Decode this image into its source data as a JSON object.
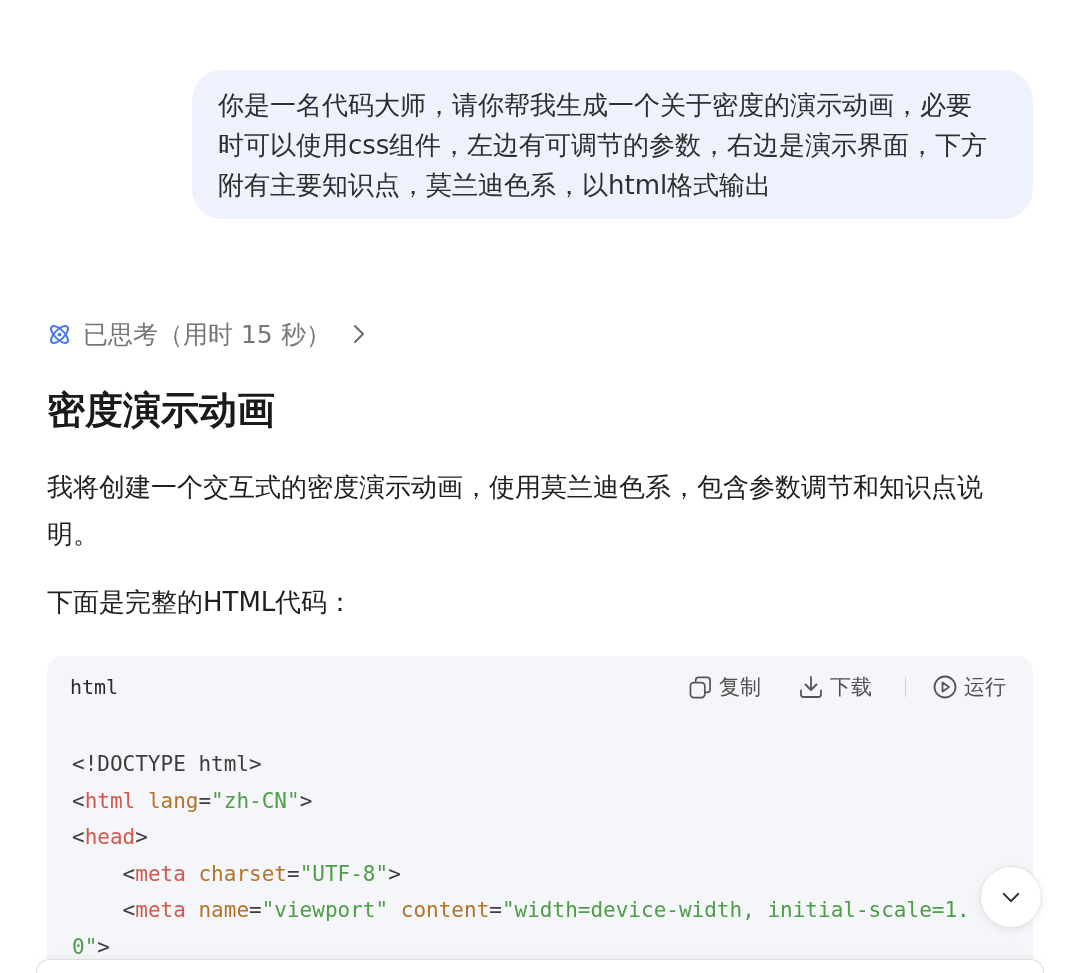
{
  "user_message": {
    "text": "你是一名代码大师，请你帮我生成一个关于密度的演示动画，必要时可以使用css组件，左边有可调节的参数，右边是演示界面，下方附有主要知识点，莫兰迪色系，以html格式输出"
  },
  "thinking": {
    "label": "已思考（用时 15 秒）",
    "expanded": false
  },
  "answer": {
    "heading": "密度演示动画",
    "paragraphs": [
      "我将创建一个交互式的密度演示动画，使用莫兰迪色系，包含参数调节和知识点说明。",
      "下面是完整的HTML代码："
    ]
  },
  "code_block": {
    "language": "html",
    "actions": [
      {
        "kind": "copy",
        "label": "复制"
      },
      {
        "kind": "download",
        "label": "下载"
      },
      {
        "kind": "separator"
      },
      {
        "kind": "run",
        "label": "运行"
      }
    ],
    "lines": [
      [
        {
          "kind": "plain",
          "text": "<!DOCTYPE html>"
        }
      ],
      [
        {
          "kind": "plain",
          "text": "<"
        },
        {
          "kind": "tag",
          "text": "html"
        },
        {
          "kind": "attr",
          "text": " lang"
        },
        {
          "kind": "plain",
          "text": "="
        },
        {
          "kind": "string",
          "text": "\"zh-CN\""
        },
        {
          "kind": "plain",
          "text": ">"
        }
      ],
      [
        {
          "kind": "plain",
          "text": "<"
        },
        {
          "kind": "tag",
          "text": "head"
        },
        {
          "kind": "plain",
          "text": ">"
        }
      ],
      [
        {
          "kind": "plain",
          "text": "    <"
        },
        {
          "kind": "tag",
          "text": "meta"
        },
        {
          "kind": "attr",
          "text": " charset"
        },
        {
          "kind": "plain",
          "text": "="
        },
        {
          "kind": "string",
          "text": "\"UTF-8\""
        },
        {
          "kind": "plain",
          "text": ">"
        }
      ],
      [
        {
          "kind": "plain",
          "text": "    <"
        },
        {
          "kind": "tag",
          "text": "meta"
        },
        {
          "kind": "attr",
          "text": " name"
        },
        {
          "kind": "plain",
          "text": "="
        },
        {
          "kind": "string",
          "text": "\"viewport\""
        },
        {
          "kind": "attr",
          "text": " content"
        },
        {
          "kind": "plain",
          "text": "="
        },
        {
          "kind": "string",
          "text": "\"width=device-width, initial-scale=1.0\""
        },
        {
          "kind": "plain",
          "text": ">"
        }
      ]
    ]
  }
}
